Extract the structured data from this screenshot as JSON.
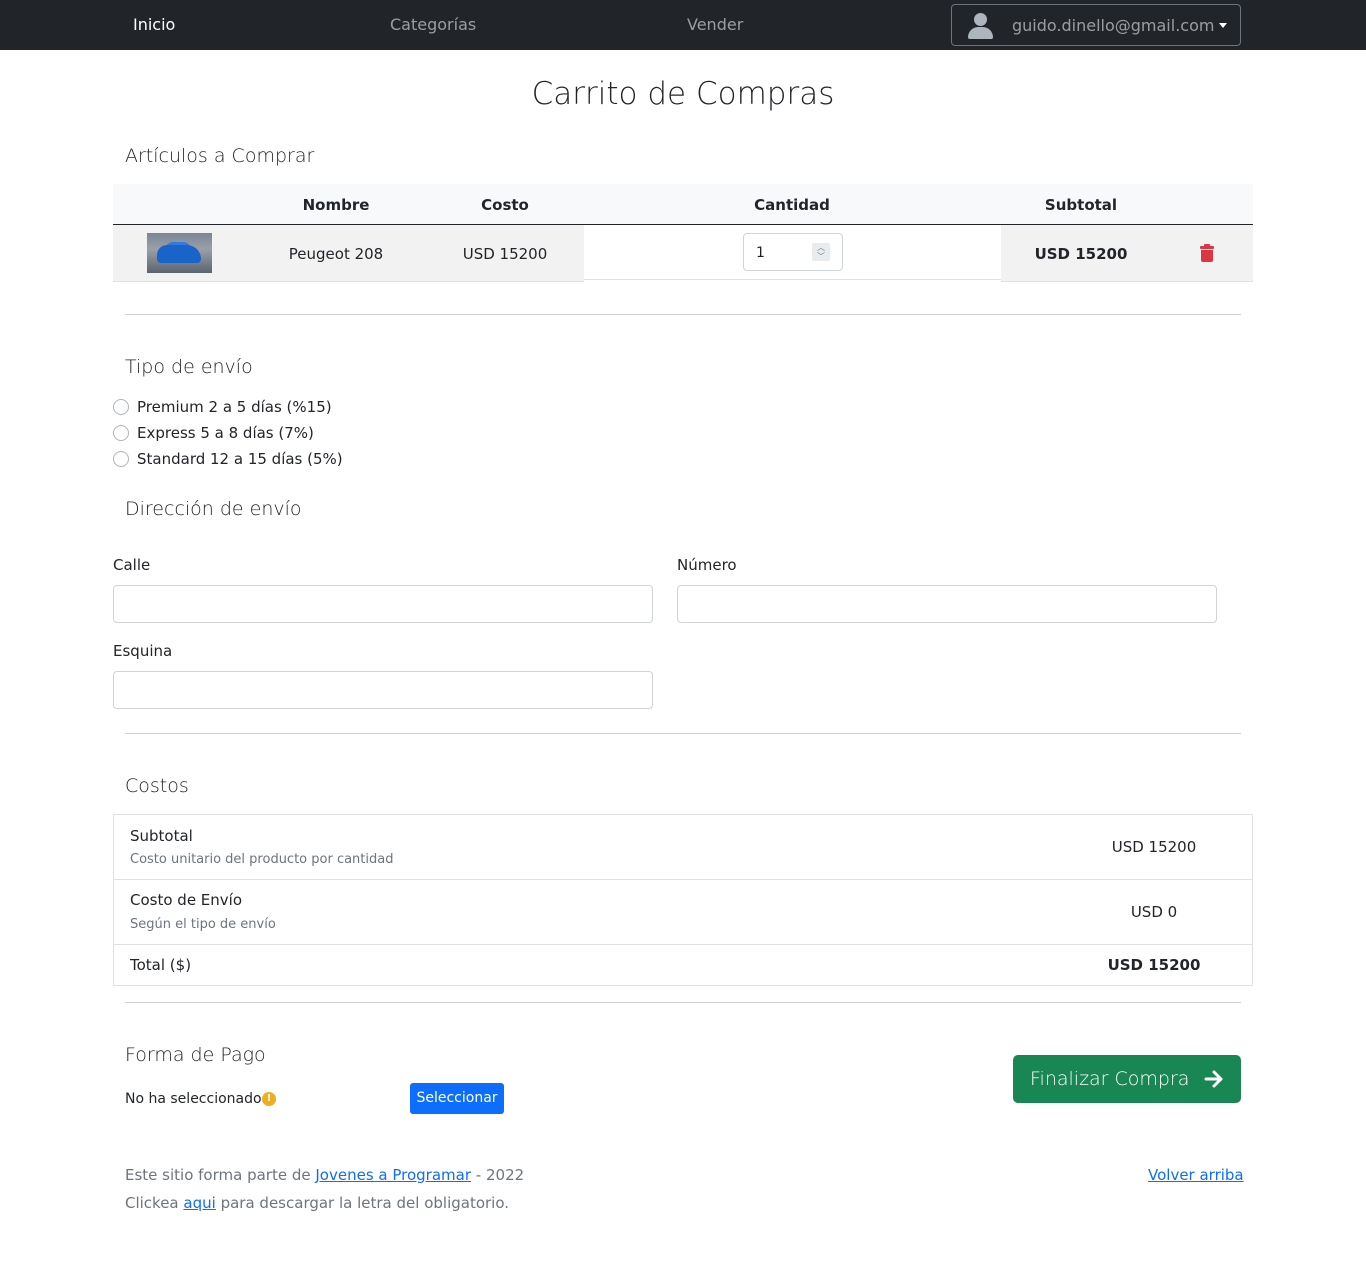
{
  "navbar": {
    "links": [
      "Inicio",
      "Categorías",
      "Vender"
    ],
    "user_email": "guido.dinello@gmail.com"
  },
  "page": {
    "title": "Carrito de Compras"
  },
  "cart": {
    "section_title": "Artículos a Comprar",
    "headers": [
      "Nombre",
      "Costo",
      "Cantidad",
      "Subtotal"
    ],
    "items": [
      {
        "name": "Peugeot 208",
        "cost": "USD 15200",
        "quantity": "1",
        "subtotal": "USD 15200"
      }
    ]
  },
  "shipping": {
    "section_title": "Tipo de envío",
    "options": [
      "Premium 2 a 5 días (%15)",
      "Express 5 a 8 días (7%)",
      "Standard 12 a 15 días (5%)"
    ]
  },
  "address": {
    "section_title": "Dirección de envío",
    "street_label": "Calle",
    "number_label": "Número",
    "corner_label": "Esquina"
  },
  "costs": {
    "section_title": "Costos",
    "subtotal_label": "Subtotal",
    "subtotal_desc": "Costo unitario del producto por cantidad",
    "subtotal_value": "USD 15200",
    "shipping_label": "Costo de Envío",
    "shipping_desc": "Según el tipo de envío",
    "shipping_value": "USD 0",
    "total_label": "Total ($)",
    "total_value": "USD 15200"
  },
  "payment": {
    "section_title": "Forma de Pago",
    "status": "No ha seleccionado",
    "select_button": "Seleccionar",
    "finalize_button": "Finalizar Compra"
  },
  "footer": {
    "line1_prefix": "Este sitio forma parte de",
    "line1_link": "Jovenes a Programar",
    "line1_suffix": "- 2022",
    "line2_prefix": "Clickea",
    "line2_link": "aqui",
    "line2_suffix": "para descargar la letra del obligatorio.",
    "back_to_top": "Volver arriba"
  }
}
